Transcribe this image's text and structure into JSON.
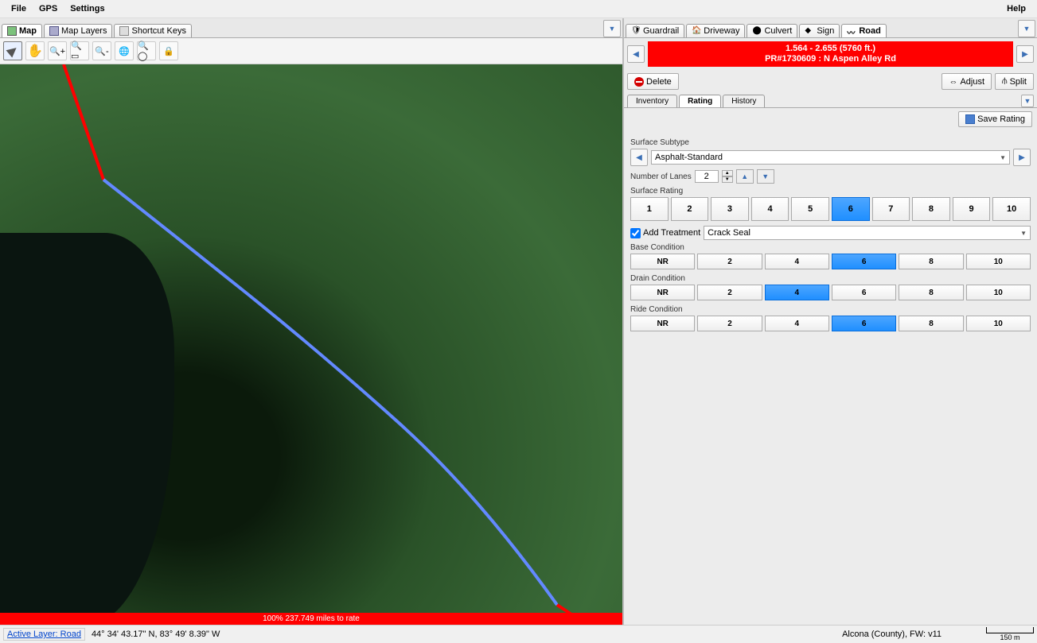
{
  "menu": {
    "file": "File",
    "gps": "GPS",
    "settings": "Settings",
    "help": "Help"
  },
  "left_tabs": {
    "map": "Map",
    "layers": "Map Layers",
    "shortcut": "Shortcut Keys"
  },
  "map_footer": "100% 237.749 miles to rate",
  "status": {
    "active_layer": "Active Layer: Road",
    "coords": "44° 34' 43.17\" N, 83° 49' 8.39\" W",
    "county": "Alcona (County), FW: v11",
    "scale": "150 m"
  },
  "right_tabs": {
    "guardrail": "Guardrail",
    "driveway": "Driveway",
    "culvert": "Culvert",
    "sign": "Sign",
    "road": "Road"
  },
  "banner": {
    "range": "1.564 - 2.655 (5760 ft.)",
    "detail": "PR#1730609 : N Aspen Alley Rd"
  },
  "actions": {
    "delete": "Delete",
    "adjust": "Adjust",
    "split": "Split"
  },
  "detail_tabs": {
    "inventory": "Inventory",
    "rating": "Rating",
    "history": "History"
  },
  "save_rating": "Save Rating",
  "surface_subtype": {
    "label": "Surface Subtype",
    "value": "Asphalt-Standard"
  },
  "lanes": {
    "label": "Number of Lanes",
    "value": "2"
  },
  "surface_rating": {
    "label": "Surface Rating",
    "options": [
      "1",
      "2",
      "3",
      "4",
      "5",
      "6",
      "7",
      "8",
      "9",
      "10"
    ],
    "selected": "6"
  },
  "add_treatment": {
    "label": "Add Treatment",
    "value": "Crack Seal",
    "checked": true
  },
  "base": {
    "label": "Base Condition",
    "options": [
      "NR",
      "2",
      "4",
      "6",
      "8",
      "10"
    ],
    "selected": "6"
  },
  "drain": {
    "label": "Drain Condition",
    "options": [
      "NR",
      "2",
      "4",
      "6",
      "8",
      "10"
    ],
    "selected": "4"
  },
  "ride": {
    "label": "Ride Condition",
    "options": [
      "NR",
      "2",
      "4",
      "6",
      "8",
      "10"
    ],
    "selected": "6"
  }
}
